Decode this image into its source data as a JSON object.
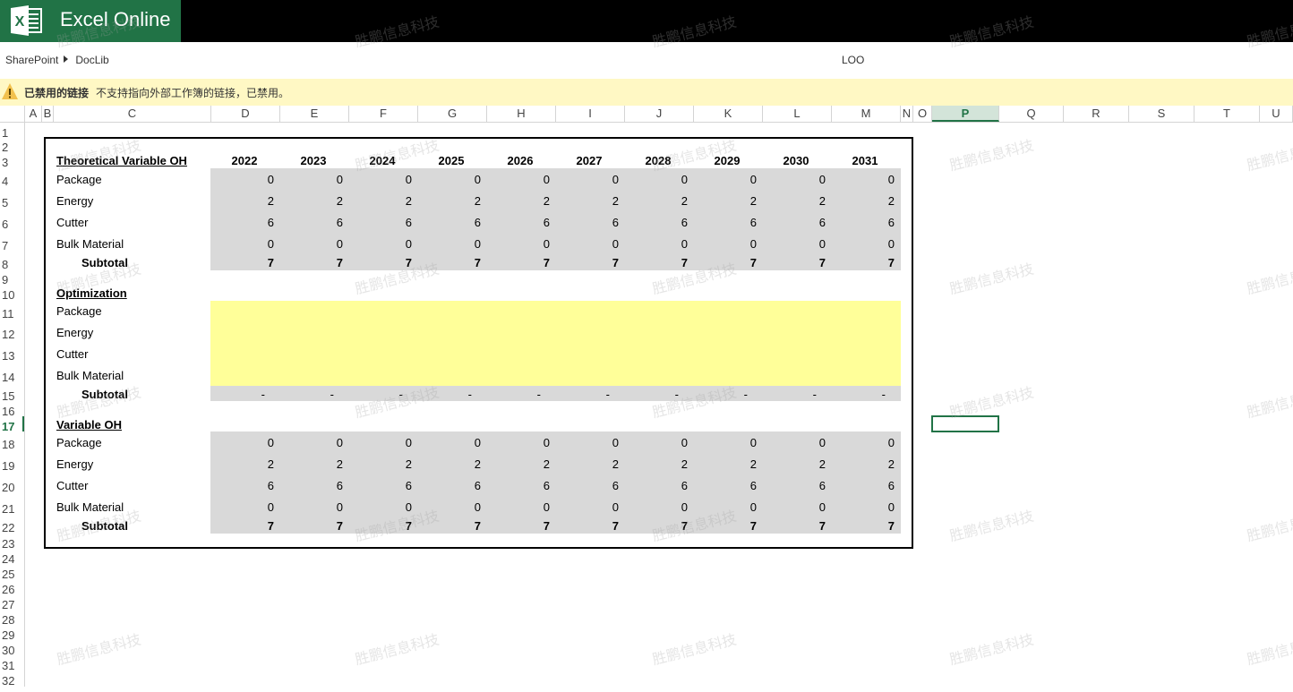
{
  "app": {
    "title": "Excel Online"
  },
  "breadcrumb": {
    "items": [
      "SharePoint",
      "DocLib"
    ]
  },
  "document": {
    "title": "LOO"
  },
  "message_bar": {
    "title": "已禁用的链接",
    "text": "不支持指向外部工作簿的链接，已禁用。"
  },
  "grid": {
    "column_headers": [
      "A",
      "B",
      "C",
      "D",
      "E",
      "F",
      "G",
      "H",
      "I",
      "J",
      "K",
      "L",
      "M",
      "N",
      "O",
      "P",
      "Q",
      "R",
      "S",
      "T",
      "U"
    ],
    "selected_column": "P",
    "row_headers": [
      "1",
      "2",
      "3",
      "4",
      "5",
      "6",
      "7",
      "8",
      "9",
      "10",
      "11",
      "12",
      "13",
      "14",
      "15",
      "16",
      "17",
      "18",
      "19",
      "20",
      "21",
      "22",
      "23",
      "24",
      "25",
      "26",
      "27",
      "28",
      "29",
      "30",
      "31",
      "32"
    ],
    "selected_row": "17"
  },
  "table": {
    "years": [
      "2022",
      "2023",
      "2024",
      "2025",
      "2026",
      "2027",
      "2028",
      "2029",
      "2030",
      "2031"
    ],
    "sections": [
      {
        "title": "Theoretical Variable OH",
        "rows": [
          {
            "label": "Package",
            "values": [
              "0",
              "0",
              "0",
              "0",
              "0",
              "0",
              "0",
              "0",
              "0",
              "0"
            ]
          },
          {
            "label": "Energy",
            "values": [
              "2",
              "2",
              "2",
              "2",
              "2",
              "2",
              "2",
              "2",
              "2",
              "2"
            ]
          },
          {
            "label": "Cutter",
            "values": [
              "6",
              "6",
              "6",
              "6",
              "6",
              "6",
              "6",
              "6",
              "6",
              "6"
            ]
          },
          {
            "label": "Bulk Material",
            "values": [
              "0",
              "0",
              "0",
              "0",
              "0",
              "0",
              "0",
              "0",
              "0",
              "0"
            ]
          }
        ],
        "subtotal": {
          "label": "Subtotal",
          "values": [
            "7",
            "7",
            "7",
            "7",
            "7",
            "7",
            "7",
            "7",
            "7",
            "7"
          ]
        }
      },
      {
        "title": "Optimization",
        "rows": [
          {
            "label": "Package",
            "values": []
          },
          {
            "label": "Energy",
            "values": []
          },
          {
            "label": "Cutter",
            "values": []
          },
          {
            "label": "Bulk Material",
            "values": []
          }
        ],
        "subtotal": {
          "label": "Subtotal",
          "values": [
            "-",
            "-",
            "-",
            "-",
            "-",
            "-",
            "-",
            "-",
            "-",
            "-"
          ]
        }
      },
      {
        "title": "Variable OH",
        "rows": [
          {
            "label": "Package",
            "values": [
              "0",
              "0",
              "0",
              "0",
              "0",
              "0",
              "0",
              "0",
              "0",
              "0"
            ]
          },
          {
            "label": "Energy",
            "values": [
              "2",
              "2",
              "2",
              "2",
              "2",
              "2",
              "2",
              "2",
              "2",
              "2"
            ]
          },
          {
            "label": "Cutter",
            "values": [
              "6",
              "6",
              "6",
              "6",
              "6",
              "6",
              "6",
              "6",
              "6",
              "6"
            ]
          },
          {
            "label": "Bulk Material",
            "values": [
              "0",
              "0",
              "0",
              "0",
              "0",
              "0",
              "0",
              "0",
              "0",
              "0"
            ]
          }
        ],
        "subtotal": {
          "label": "Subtotal",
          "values": [
            "7",
            "7",
            "7",
            "7",
            "7",
            "7",
            "7",
            "7",
            "7",
            "7"
          ]
        }
      }
    ]
  },
  "watermark": {
    "text": "胜鹏信息科技"
  },
  "colors": {
    "brand": "#217346",
    "input_fill": "#ffff99",
    "calc_fill": "#d9d9d9",
    "message_bar": "#fff8c4"
  },
  "icons": {
    "logo": "excel-logo-icon",
    "warning": "warning-icon",
    "breadcrumb_separator": "chevron-right-icon"
  }
}
